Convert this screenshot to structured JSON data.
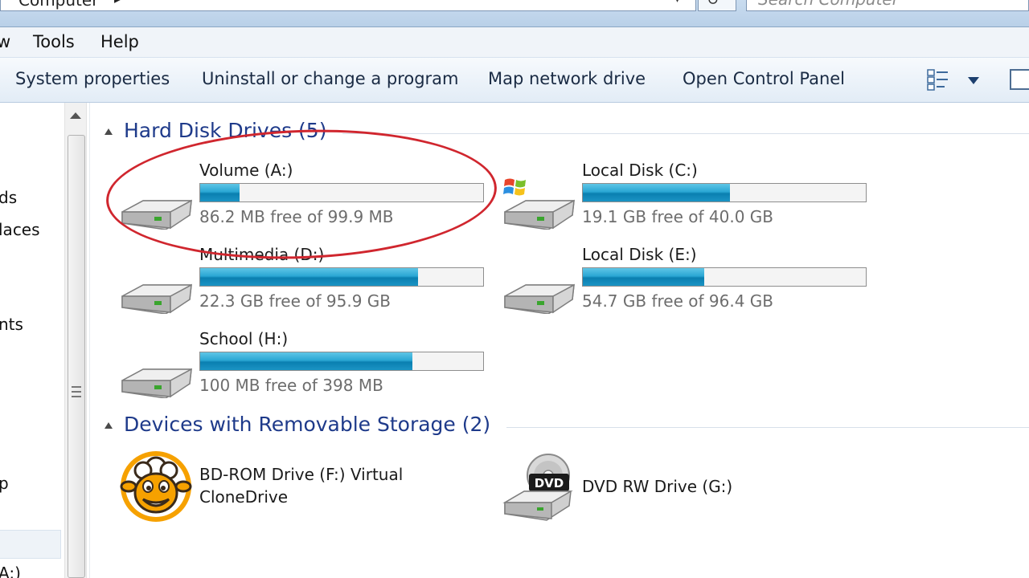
{
  "address": {
    "path_segment": "Computer",
    "search_placeholder": "Search Computer"
  },
  "menubar": {
    "items": [
      "w",
      "Tools",
      "Help"
    ]
  },
  "commandbar": {
    "system_properties": "System properties",
    "uninstall": "Uninstall or change a program",
    "map_drive": "Map network drive",
    "control_panel": "Open Control Panel"
  },
  "navpane": {
    "items": [
      "ds",
      "laces",
      "nts",
      "p",
      "A:)"
    ]
  },
  "groups": {
    "hard_disks": {
      "title": "Hard Disk Drives (5)"
    },
    "removable": {
      "title": "Devices with Removable Storage (2)"
    }
  },
  "drives": [
    {
      "name": "Volume (A:)",
      "free_text": "86.2 MB free of 99.9 MB",
      "used_fraction": 0.14,
      "icon": "hard-drive-icon"
    },
    {
      "name": "Local Disk (C:)",
      "free_text": "19.1 GB free of 40.0 GB",
      "used_fraction": 0.52,
      "icon": "windows-drive-icon"
    },
    {
      "name": "Multimedia (D:)",
      "free_text": "22.3 GB free of 95.9 GB",
      "used_fraction": 0.77,
      "icon": "hard-drive-icon"
    },
    {
      "name": "Local Disk (E:)",
      "free_text": "54.7 GB free of 96.4 GB",
      "used_fraction": 0.43,
      "icon": "hard-drive-icon"
    },
    {
      "name": "School (H:)",
      "free_text": "100 MB free of 398 MB",
      "used_fraction": 0.75,
      "icon": "hard-drive-icon"
    }
  ],
  "devices": [
    {
      "name": "BD-ROM Drive (F:) Virtual CloneDrive",
      "icon": "clonedrive-sheep-icon"
    },
    {
      "name": "DVD RW Drive (G:)",
      "icon": "dvd-drive-icon",
      "badge": "DVD"
    }
  ],
  "colors": {
    "annotation": "#d0262e",
    "group_title": "#1e3a8a",
    "bar_fill": "#2aa7d4"
  }
}
